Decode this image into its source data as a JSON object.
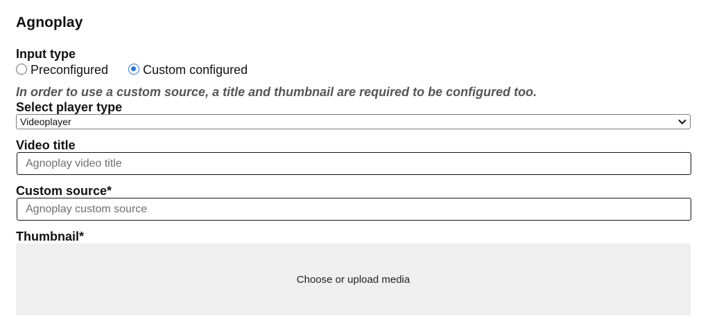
{
  "block": {
    "title": "Agnoplay"
  },
  "input_type": {
    "label": "Input type",
    "options": [
      {
        "label": "Preconfigured",
        "checked": false
      },
      {
        "label": "Custom configured",
        "checked": true
      }
    ]
  },
  "notice": "In order to use a custom source, a title and thumbnail are required to be configured too.",
  "player_type": {
    "label": "Select player type",
    "selected": "Videoplayer"
  },
  "video_title": {
    "label": "Video title",
    "placeholder": "Agnoplay video title"
  },
  "custom_source": {
    "label": "Custom source*",
    "placeholder": "Agnoplay custom source"
  },
  "thumbnail": {
    "label": "Thumbnail*",
    "action": "Choose or upload media"
  },
  "colors": {
    "accent": "#2b74d9",
    "media_bg": "#efefef",
    "notice_text": "#555555"
  }
}
